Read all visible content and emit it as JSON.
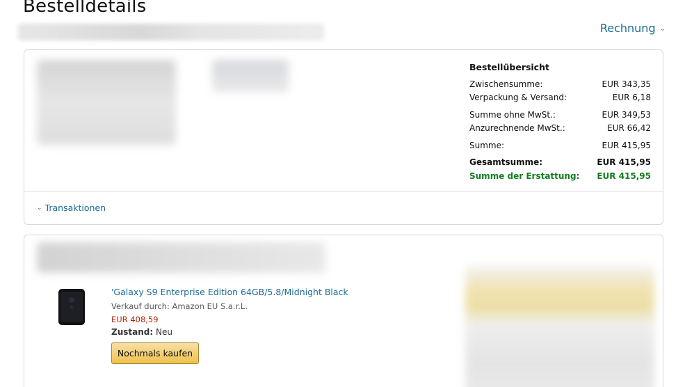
{
  "page": {
    "title": "Bestelldetails"
  },
  "header": {
    "invoice_label": "Rechnung"
  },
  "summary": {
    "heading": "Bestellübersicht",
    "rows": [
      {
        "label": "Zwischensumme:",
        "value": "EUR 343,35"
      },
      {
        "label": "Verpackung & Versand:",
        "value": "EUR 6,18"
      },
      {
        "label": "Summe ohne MwSt.:",
        "value": "EUR 349,53"
      },
      {
        "label": "Anzurechnende MwSt.:",
        "value": "EUR 66,42"
      },
      {
        "label": "Summe:",
        "value": "EUR 415,95"
      },
      {
        "label": "Gesamtsumme:",
        "value": "EUR 415,95"
      },
      {
        "label": "Summe der Erstattung:",
        "value": "EUR 415,95"
      }
    ]
  },
  "transactions": {
    "label": "Transaktionen"
  },
  "item": {
    "title": "'Galaxy S9 Enterprise Edition 64GB/5.8/Midnight Black",
    "seller": "Verkauf durch: Amazon EU S.a.r.L.",
    "price": "EUR 408,59",
    "condition_label": "Zustand:",
    "condition_value": "Neu",
    "buy_again_label": "Nochmals kaufen"
  },
  "colors": {
    "link": "#1a6c96",
    "refund_green": "#147c20",
    "price_red": "#b12704",
    "button_yellow": "#f0c14b"
  }
}
